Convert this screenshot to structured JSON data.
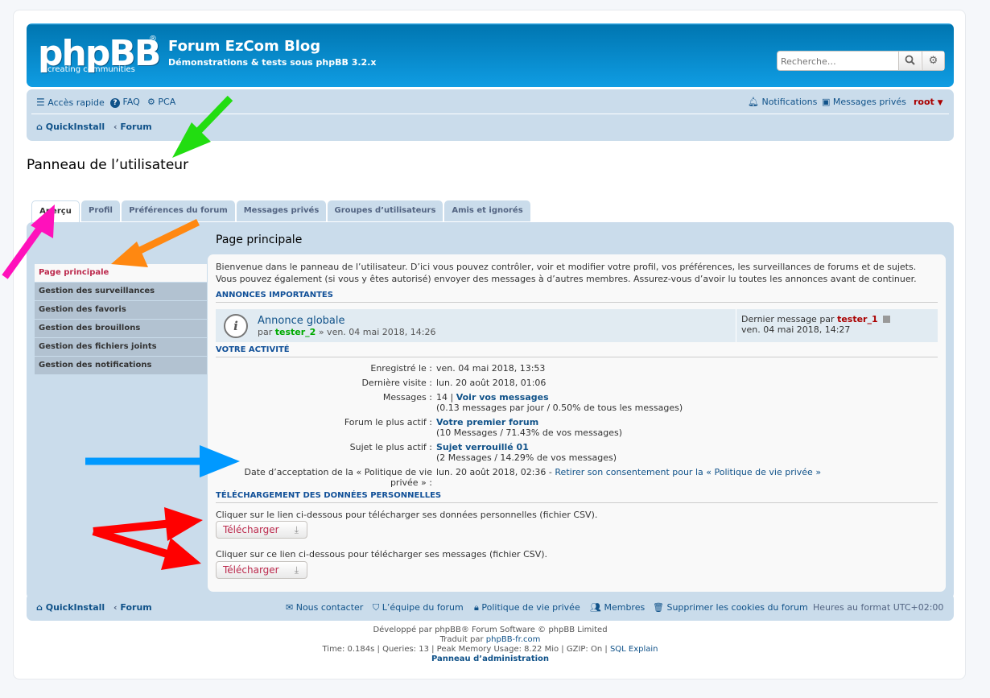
{
  "header": {
    "logo_text": "phpBB",
    "logo_reg": "®",
    "logo_tagline": "creating  communities",
    "site_title": "Forum EzCom Blog",
    "site_description": "Démonstrations & tests sous phpBB 3.2.x",
    "search_placeholder": "Recherche…"
  },
  "nav": {
    "quick_access": "Accès rapide",
    "faq": "FAQ",
    "pca": "PCA",
    "notifications": "Notifications",
    "private_messages": "Messages privés",
    "username": "root",
    "breadcrumb": [
      "QuickInstall",
      "Forum"
    ]
  },
  "page_title": "Panneau de l’utilisateur",
  "tabs": [
    {
      "label": "Aperçu",
      "active": true
    },
    {
      "label": "Profil"
    },
    {
      "label": "Préférences du forum"
    },
    {
      "label": "Messages privés"
    },
    {
      "label": "Groupes d’utilisateurs"
    },
    {
      "label": "Amis et ignorés"
    }
  ],
  "menu": [
    {
      "label": "Page principale",
      "active": true
    },
    {
      "label": "Gestion des surveillances"
    },
    {
      "label": "Gestion des favoris"
    },
    {
      "label": "Gestion des brouillons"
    },
    {
      "label": "Gestion des fichiers joints"
    },
    {
      "label": "Gestion des notifications"
    }
  ],
  "main": {
    "title": "Page principale",
    "intro_1": "Bienvenue dans le panneau de l’utilisateur. D’ici vous pouvez contrôler, voir et modifier votre profil, vos préférences, les surveillances de forums et de sujets.",
    "intro_2": "Vous pouvez également (si vous y êtes autorisé) envoyer des messages à d’autres membres. Assurez-vous d’avoir lu toutes les annonces avant de continuer.",
    "announcements_heading": "ANNONCES IMPORTANTES",
    "announcement": {
      "title": "Annonce globale",
      "by_prefix": "par",
      "author": "tester_2",
      "date": "» ven. 04 mai 2018, 14:26",
      "last_prefix": "Dernier message par",
      "last_author": "tester_1",
      "last_date": "ven. 04 mai 2018, 14:27"
    },
    "activity_heading": "VOTRE ACTIVITÉ",
    "stats": {
      "registered_label": "Enregistré le :",
      "registered_value": "ven. 04 mai 2018, 13:53",
      "last_visit_label": "Dernière visite :",
      "last_visit_value": "lun. 20 août 2018, 01:06",
      "messages_label": "Messages :",
      "messages_count": "14 |",
      "messages_link": "Voir vos messages",
      "messages_detail": "(0.13 messages par jour / 0.50% de tous les messages)",
      "active_forum_label": "Forum le plus actif :",
      "active_forum_link": "Votre premier forum",
      "active_forum_detail": "(10 Messages / 71.43% de vos messages)",
      "active_topic_label": "Sujet le plus actif :",
      "active_topic_link": "Sujet verrouillé 01",
      "active_topic_detail": "(2 Messages / 14.29% de vos messages)",
      "privacy_label_1": "Date d’acceptation de la « Politique de vie",
      "privacy_label_2": "privée » :",
      "privacy_value": "lun. 20 août 2018, 02:36 -",
      "privacy_link": "Retirer son consentement pour la « Politique de vie privée »"
    },
    "download_heading": "TÉLÉCHARGEMENT DES DONNÉES PERSONNELLES",
    "download_text_1": "Cliquer sur le lien ci-dessous pour télécharger ses données personnelles (fichier CSV).",
    "download_text_2": "Cliquer sur ce lien ci-dessous pour télécharger ses messages (fichier CSV).",
    "download_button": "Télécharger"
  },
  "footer": {
    "breadcrumb": [
      "QuickInstall",
      "Forum"
    ],
    "contact": "Nous contacter",
    "team": "L’équipe du forum",
    "privacy": "Politique de vie privée",
    "members": "Membres",
    "delete_cookies": "Supprimer les cookies du forum",
    "timezone": "Heures au format UTC+02:00",
    "credit_1": "Développé par phpBB® Forum Software © phpBB Limited",
    "credit_2_prefix": "Traduit par",
    "credit_2_link": "phpBB-fr.com",
    "debug": "Time: 0.184s | Queries: 13 | Peak Memory Usage: 8.22 Mio | GZIP: On |",
    "sql_explain": "SQL Explain",
    "admin_panel": "Panneau d’administration"
  },
  "colors": {
    "header_blue": "#12a3eb",
    "nav_bg": "#cadceb",
    "link": "#105289",
    "arrow_green": "#22dd11",
    "arrow_orange": "#ff8811",
    "arrow_magenta": "#ff11bb",
    "arrow_blue": "#0099ff",
    "arrow_red": "#ff0000"
  }
}
